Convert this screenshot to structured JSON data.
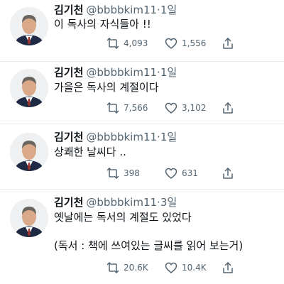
{
  "tweets": [
    {
      "name": "김기천",
      "handle": "@bbbbkim11",
      "separator": "·",
      "time": "1일",
      "text_lines": [
        "이 독사의 자식들아 !!"
      ],
      "retweets": "4,093",
      "likes": "1,556"
    },
    {
      "name": "김기천",
      "handle": "@bbbbkim11",
      "separator": "·",
      "time": "1일",
      "text_lines": [
        "가을은 독사의 계절이다"
      ],
      "retweets": "7,566",
      "likes": "3,102"
    },
    {
      "name": "김기천",
      "handle": "@bbbbkim11",
      "separator": "·",
      "time": "1일",
      "text_lines": [
        "상쾌한 날씨다 .."
      ],
      "retweets": "398",
      "likes": "631"
    },
    {
      "name": "김기천",
      "handle": "@bbbbkim11",
      "separator": "·",
      "time": "3일",
      "text_lines": [
        "옛날에는 독서의 계절도 있었다",
        "(독서 : 책에 쓰여있는 글씨를 읽어 보는거)"
      ],
      "retweets": "20.6K",
      "likes": "10.4K"
    }
  ],
  "icons": {
    "reply": "reply-icon",
    "retweet": "retweet-icon",
    "like": "heart-icon",
    "share": "share-icon"
  },
  "colors": {
    "text": "#0f1419",
    "muted": "#536471",
    "divider": "#e6ecf0",
    "suit": "#1f2a44"
  }
}
